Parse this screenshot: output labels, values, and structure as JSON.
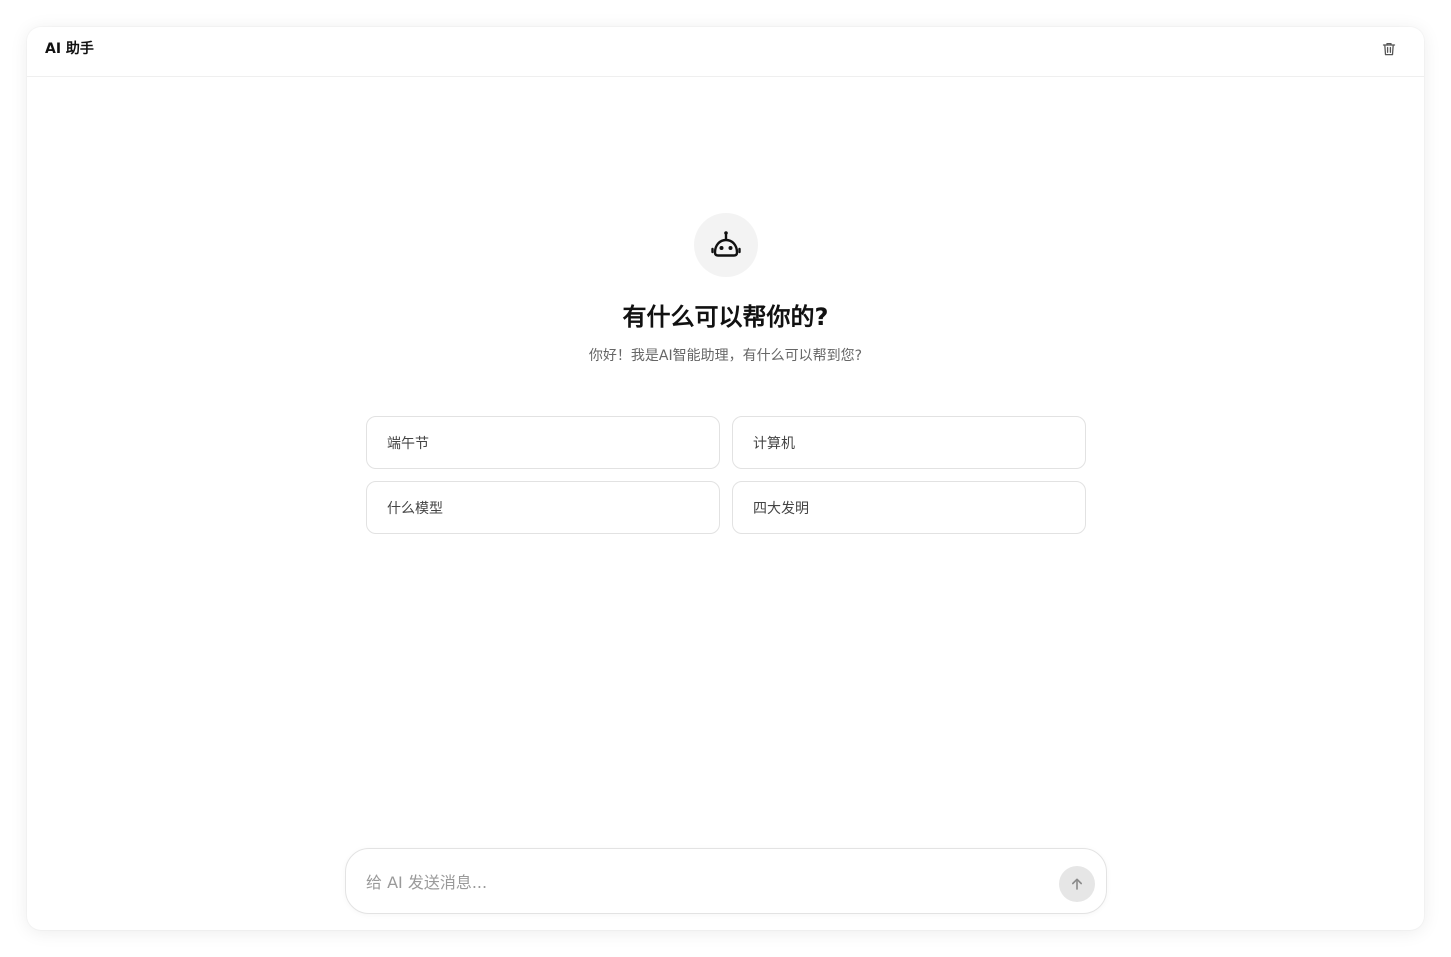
{
  "header": {
    "title": "AI 助手",
    "clear_icon": "trash-icon"
  },
  "welcome": {
    "avatar_icon": "robot-icon",
    "headline": "有什么可以帮你的?",
    "subline": "你好！我是AI智能助理，有什么可以帮到您?"
  },
  "suggestions": [
    {
      "label": "端午节"
    },
    {
      "label": "计算机"
    },
    {
      "label": "什么模型"
    },
    {
      "label": "四大发明"
    }
  ],
  "composer": {
    "placeholder": "给 AI 发送消息...",
    "value": "",
    "send_icon": "arrow-up-icon"
  },
  "colors": {
    "background": "#ffffff",
    "border": "#e2e2e2",
    "avatar_bg": "#f3f3f3",
    "send_button_bg": "#e6e6e6"
  }
}
